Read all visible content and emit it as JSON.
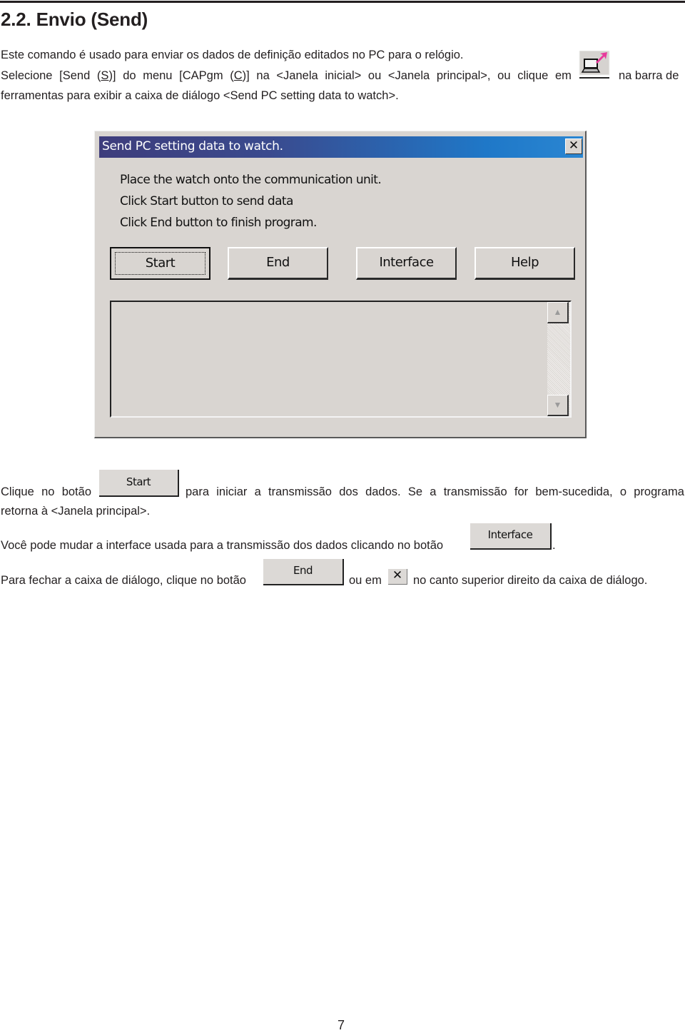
{
  "heading": "2.2. Envio (Send)",
  "intro": {
    "line1": "Este comando é usado para enviar os dados de definição editados no PC para o relógio.",
    "line2_words": [
      "Selecione",
      "[Send",
      "(S)]",
      "do",
      "menu",
      "[CAPgm",
      "(C)]",
      "na",
      "<Janela",
      "inicial>",
      "ou",
      "<Janela",
      "principal>,",
      "ou",
      "clique",
      "em"
    ],
    "line2_tail": "na barra de",
    "line3": "ferramentas para exibir a caixa de diálogo <Send PC setting data to watch>.",
    "toolbar_icon": "send-to-watch-icon"
  },
  "dialog": {
    "title": "Send PC setting data to watch.",
    "close_glyph": "✕",
    "messages": [
      "Place the watch onto the communication unit.",
      "Click Start button to send data",
      "Click End button to finish program."
    ],
    "buttons": [
      "Start",
      "End",
      "Interface",
      "Help"
    ],
    "log_text": "",
    "scroll_up_glyph": "▲",
    "scroll_down_glyph": "▼"
  },
  "body": {
    "start_para": {
      "words_before": [
        "Clique",
        "no",
        "botão"
      ],
      "button": "Start",
      "words_after": [
        "para",
        "iniciar",
        "a",
        "transmissão",
        "dos",
        "dados.",
        "Se",
        "a",
        "transmissão",
        "for",
        "bem-sucedida,",
        "o",
        "programa"
      ],
      "line2": "retorna à <Janela principal>."
    },
    "interface_para": {
      "text": "Você pode mudar a interface usada para a transmissão dos dados clicando no botão",
      "button": "Interface",
      "end": "."
    },
    "close_para": {
      "text_before": "Para fechar a caixa de diálogo, clique no botão",
      "button": "End",
      "text_middle": "ou em",
      "close_glyph": "✕",
      "text_after": "no canto superior direito da caixa de diálogo."
    }
  },
  "page_number": "7",
  "colors": {
    "titlebar_start": "#3e3d7c",
    "titlebar_end": "#2a86d2",
    "dialog_face": "#d9d5d1",
    "text": "#231f20"
  }
}
